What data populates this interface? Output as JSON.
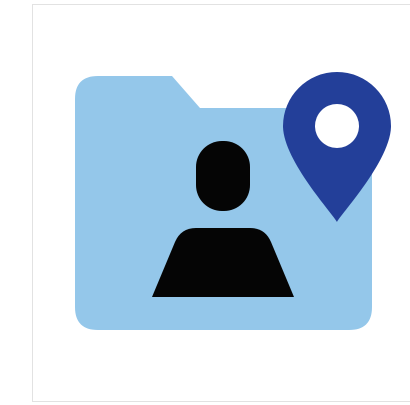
{
  "icon": {
    "semantic_name": "folder-user-location-icon",
    "parts": {
      "folder": "folder-icon",
      "person": "user-icon",
      "pin": "location-pin-icon"
    },
    "colors": {
      "background": "#ffffff",
      "frame_border": "#e2e2e2",
      "folder_fill": "#94c7ea",
      "person_fill": "#050505",
      "pin_fill": "#233f99",
      "pin_hole": "#ffffff"
    }
  }
}
